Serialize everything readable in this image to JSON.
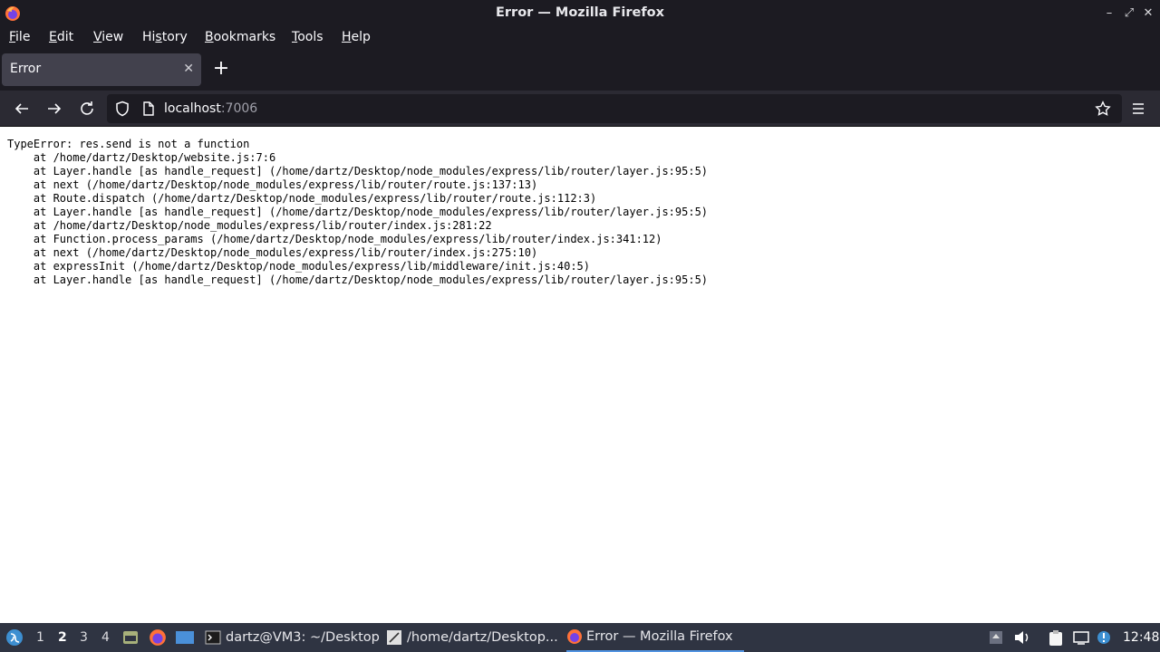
{
  "window": {
    "title": "Error — Mozilla Firefox"
  },
  "menubar": {
    "items": [
      {
        "pre": "",
        "ul": "F",
        "post": "ile"
      },
      {
        "pre": "",
        "ul": "E",
        "post": "dit"
      },
      {
        "pre": "",
        "ul": "V",
        "post": "iew"
      },
      {
        "pre": "Hi",
        "ul": "s",
        "post": "tory"
      },
      {
        "pre": "",
        "ul": "B",
        "post": "ookmarks"
      },
      {
        "pre": "",
        "ul": "T",
        "post": "ools"
      },
      {
        "pre": "",
        "ul": "H",
        "post": "elp"
      }
    ]
  },
  "tabs": {
    "active_tab_title": "Error",
    "new_tab_glyph": "+",
    "close_glyph": "✕"
  },
  "navbar": {
    "url_host": "localhost",
    "url_port": ":7006"
  },
  "content": {
    "error_text": "TypeError: res.send is not a function\n    at /home/dartz/Desktop/website.js:7:6\n    at Layer.handle [as handle_request] (/home/dartz/Desktop/node_modules/express/lib/router/layer.js:95:5)\n    at next (/home/dartz/Desktop/node_modules/express/lib/router/route.js:137:13)\n    at Route.dispatch (/home/dartz/Desktop/node_modules/express/lib/router/route.js:112:3)\n    at Layer.handle [as handle_request] (/home/dartz/Desktop/node_modules/express/lib/router/layer.js:95:5)\n    at /home/dartz/Desktop/node_modules/express/lib/router/index.js:281:22\n    at Function.process_params (/home/dartz/Desktop/node_modules/express/lib/router/index.js:341:12)\n    at next (/home/dartz/Desktop/node_modules/express/lib/router/index.js:275:10)\n    at expressInit (/home/dartz/Desktop/node_modules/express/lib/middleware/init.js:40:5)\n    at Layer.handle [as handle_request] (/home/dartz/Desktop/node_modules/express/lib/router/layer.js:95:5)"
  },
  "taskbar": {
    "workspaces": [
      "1",
      "2",
      "3",
      "4"
    ],
    "active_workspace": "2",
    "tasks": [
      {
        "label": "dartz@VM3: ~/Desktop",
        "icon": "terminal-icon"
      },
      {
        "label": "/home/dartz/Desktop...",
        "icon": "text-editor-icon"
      },
      {
        "label": "Error — Mozilla Firefox",
        "icon": "firefox-icon"
      }
    ],
    "clock": "12:48"
  },
  "colors": {
    "chrome_dark": "#1c1b22",
    "toolbar": "#2b2a33",
    "tab_active": "#42414d",
    "taskbar": "#2f3442",
    "accent": "#5294e2"
  }
}
